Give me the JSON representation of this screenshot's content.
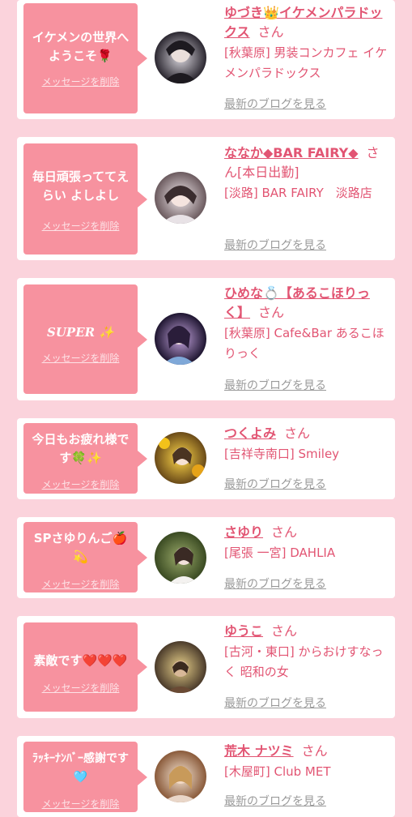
{
  "cards": [
    {
      "message": "イケメンの世界へようこそ🌹",
      "delete_label": "メッセージを削除",
      "name": "ゆづき👑イケメンパラドックス",
      "honorific": "さん",
      "shop": "[秋葉原] 男装コンカフェ イケメンパラドックス",
      "blog_label": "最新のブログを見る",
      "avatar_colors": [
        "#d9d6dd",
        "#2b2730"
      ]
    },
    {
      "message": "毎日頑張っててえらい よしよし",
      "delete_label": "メッセージを削除",
      "name": "ななか◆BAR FAIRY◆",
      "honorific": "さん",
      "shop_prefix": "[本日出勤]",
      "shop": "[淡路] BAR FAIRY　淡路店",
      "blog_label": "最新のブログを見る",
      "avatar_colors": [
        "#efe6ec",
        "#6b5a5e"
      ]
    },
    {
      "message": "SUPER ✨",
      "delete_label": "メッセージを削除",
      "name": "ひめな💍【あるこほりっく】",
      "honorific": "さん",
      "shop": "[秋葉原] Cafe&Bar あるこほりっく",
      "blog_label": "最新のブログを見る",
      "avatar_colors": [
        "#3b2a5a",
        "#c6a6e0"
      ]
    },
    {
      "message": "今日もお疲れ様です🍀✨",
      "delete_label": "メッセージを削除",
      "name": "つくよみ",
      "honorific": "さん",
      "shop": "[吉祥寺南口] Smiley",
      "blog_label": "最新のブログを見る",
      "avatar_colors": [
        "#e6b020",
        "#6a4a18"
      ]
    },
    {
      "message": "SPさゆりんご🍎💫",
      "delete_label": "メッセージを削除",
      "name": "さゆり",
      "honorific": "さん",
      "shop": "[尾張 一宮] DAHLIA",
      "blog_label": "最新のブログを見る",
      "avatar_colors": [
        "#5a6a3a",
        "#e8e4e2"
      ]
    },
    {
      "message": "素敵です❤️❤️❤️",
      "delete_label": "メッセージを削除",
      "name": "ゆうこ",
      "honorific": "さん",
      "shop": "[古河・東口] からおけすなっく 昭和の女",
      "blog_label": "最新のブログを見る",
      "avatar_colors": [
        "#c9a85a",
        "#4a3a2a"
      ]
    },
    {
      "message": "ﾗｯｷｰﾅﾝﾊﾞｰ感謝です🩵",
      "delete_label": "メッセージを削除",
      "name": "荒木 ナツミ",
      "honorific": "さん",
      "shop": "[木屋町] Club MET",
      "blog_label": "最新のブログを見る",
      "avatar_colors": [
        "#e2c3a4",
        "#8a5a3a"
      ]
    }
  ]
}
